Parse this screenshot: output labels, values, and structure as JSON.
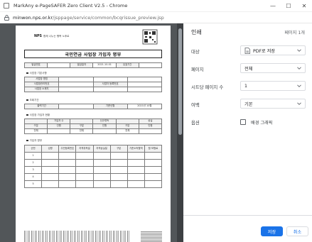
{
  "window": {
    "title": "MarkAny e-PageSAFER Zero Client V2.5 - Chrome",
    "minimize_glyph": "—",
    "maximize_glyph": "☐",
    "close_glyph": "✕"
  },
  "address": {
    "host": "minwon.nps.or.kr",
    "path": "/jsppage/service/common/bcqrissue_preview.jsp"
  },
  "document": {
    "brand_name": "NPS",
    "brand_tagline": "함께 나누는 행복 노후로",
    "title": "국민연금 사업장 가입자 명부",
    "header_row": [
      {
        "text": "발급번호",
        "h": true,
        "m": false
      },
      {
        "text": "",
        "h": false,
        "m": true
      },
      {
        "text": "발급일자",
        "h": true,
        "m": false
      },
      {
        "text": "2021-10-01",
        "h": false,
        "m": false
      },
      {
        "text": "유효기간",
        "h": true,
        "m": false
      },
      {
        "text": "",
        "h": false,
        "m": true
      }
    ],
    "section_applicant": "사업장 기본사항",
    "applicant_rows": [
      [
        {
          "text": "사업장 명칭",
          "h": true,
          "m": false
        },
        {
          "text": "",
          "h": false,
          "m": true
        },
        {
          "text": "",
          "h": false,
          "m": true
        },
        {
          "text": "",
          "h": false,
          "m": true
        }
      ],
      [
        {
          "text": "사업장관리번호",
          "h": true,
          "m": false
        },
        {
          "text": "",
          "h": false,
          "m": true
        },
        {
          "text": "사업자 등록번호",
          "h": true,
          "m": false
        },
        {
          "text": "",
          "h": false,
          "m": true
        }
      ],
      [
        {
          "text": "사업장 소재지",
          "h": true,
          "m": false
        },
        {
          "text": "",
          "h": false,
          "m": true
        },
        {
          "text": "",
          "h": false,
          "m": true
        },
        {
          "text": "",
          "h": false,
          "m": true
        }
      ]
    ],
    "section_period": "조회기간",
    "period_row": [
      {
        "text": "출력기간",
        "h": true,
        "m": false
      },
      {
        "text": "",
        "h": false,
        "m": true
      },
      {
        "text": "기준년월",
        "h": true,
        "m": false
      },
      {
        "text": "2021년 10월",
        "h": false,
        "m": false
      }
    ],
    "section_summary": "사업장 가입자 현황",
    "summary_rows": [
      [
        {
          "text": "",
          "h": true,
          "m": false
        },
        {
          "text": "가입자 수",
          "h": true,
          "m": false
        },
        {
          "text": "",
          "h": true,
          "m": false
        },
        {
          "text": "신규취득",
          "h": true,
          "m": false
        },
        {
          "text": "",
          "h": true,
          "m": false
        },
        {
          "text": "상실",
          "h": true,
          "m": false
        }
      ],
      [
        {
          "text": "구분",
          "h": true,
          "m": false
        },
        {
          "text": "인원",
          "h": true,
          "m": false
        },
        {
          "text": "구분",
          "h": true,
          "m": false
        },
        {
          "text": "인원",
          "h": true,
          "m": false
        },
        {
          "text": "구분",
          "h": true,
          "m": false
        },
        {
          "text": "인원",
          "h": true,
          "m": false
        }
      ],
      [
        {
          "text": "전체",
          "h": false,
          "m": false
        },
        {
          "text": "",
          "h": false,
          "m": true
        },
        {
          "text": "전체",
          "h": false,
          "m": false
        },
        {
          "text": "",
          "h": false,
          "m": true
        },
        {
          "text": "전체",
          "h": false,
          "m": false
        },
        {
          "text": "",
          "h": false,
          "m": true
        }
      ]
    ],
    "section_members": "가입자 명부",
    "members_header": [
      {
        "text": "순번",
        "h": true,
        "m": false
      },
      {
        "text": "성명",
        "h": true,
        "m": false
      },
      {
        "text": "주민등록번호",
        "h": true,
        "m": false
      },
      {
        "text": "자격취득일",
        "h": true,
        "m": false
      },
      {
        "text": "자격상실일",
        "h": true,
        "m": false
      },
      {
        "text": "구분",
        "h": true,
        "m": false
      },
      {
        "text": "기준소득월액",
        "h": true,
        "m": false
      },
      {
        "text": "월 보험료",
        "h": true,
        "m": false
      }
    ],
    "members_rows": [
      [
        {
          "text": "1",
          "h": false,
          "m": false
        },
        {
          "text": "",
          "h": false,
          "m": true
        },
        {
          "text": "",
          "h": false,
          "m": true
        },
        {
          "text": "",
          "h": false,
          "m": true
        },
        {
          "text": "",
          "h": false,
          "m": true
        },
        {
          "text": "",
          "h": false,
          "m": true
        },
        {
          "text": "",
          "h": false,
          "m": true
        },
        {
          "text": "",
          "h": false,
          "m": true
        }
      ],
      [
        {
          "text": "2",
          "h": false,
          "m": false
        },
        {
          "text": "",
          "h": false,
          "m": true
        },
        {
          "text": "",
          "h": false,
          "m": true
        },
        {
          "text": "",
          "h": false,
          "m": true
        },
        {
          "text": "",
          "h": false,
          "m": true
        },
        {
          "text": "",
          "h": false,
          "m": true
        },
        {
          "text": "",
          "h": false,
          "m": true
        },
        {
          "text": "",
          "h": false,
          "m": true
        }
      ],
      [
        {
          "text": "3",
          "h": false,
          "m": false
        },
        {
          "text": "",
          "h": false,
          "m": true
        },
        {
          "text": "",
          "h": false,
          "m": true
        },
        {
          "text": "",
          "h": false,
          "m": true
        },
        {
          "text": "",
          "h": false,
          "m": true
        },
        {
          "text": "",
          "h": false,
          "m": true
        },
        {
          "text": "",
          "h": false,
          "m": true
        },
        {
          "text": "",
          "h": false,
          "m": true
        }
      ],
      [
        {
          "text": "4",
          "h": false,
          "m": false
        },
        {
          "text": "",
          "h": false,
          "m": true
        },
        {
          "text": "",
          "h": false,
          "m": true
        },
        {
          "text": "",
          "h": false,
          "m": true
        },
        {
          "text": "",
          "h": false,
          "m": true
        },
        {
          "text": "",
          "h": false,
          "m": true
        },
        {
          "text": "",
          "h": false,
          "m": true
        },
        {
          "text": "",
          "h": false,
          "m": true
        }
      ],
      [
        {
          "text": "5",
          "h": false,
          "m": false
        },
        {
          "text": "",
          "h": false,
          "m": true
        },
        {
          "text": "",
          "h": false,
          "m": true
        },
        {
          "text": "",
          "h": false,
          "m": true
        },
        {
          "text": "",
          "h": false,
          "m": true
        },
        {
          "text": "",
          "h": false,
          "m": true
        },
        {
          "text": "",
          "h": false,
          "m": true
        },
        {
          "text": "",
          "h": false,
          "m": true
        }
      ]
    ]
  },
  "print": {
    "title": "인쇄",
    "page_count": "페이지 1개",
    "destination_label": "대상",
    "destination_value": "PDF로 저장",
    "pages_label": "페이지",
    "pages_value": "전체",
    "pages_per_sheet_label": "시트당 페이지 수",
    "pages_per_sheet_value": "1",
    "margins_label": "여백",
    "margins_value": "기본",
    "options_label": "옵션",
    "background_graphics_label": "배경 그래픽",
    "background_graphics_checked": false,
    "save_label": "저장",
    "cancel_label": "취소"
  },
  "colors": {
    "accent": "#1a73e8",
    "preview_background": "#525659"
  },
  "icons": {
    "lock": "lock-icon",
    "pdf": "pdf-icon",
    "dropdown": "chevron-down-icon"
  }
}
